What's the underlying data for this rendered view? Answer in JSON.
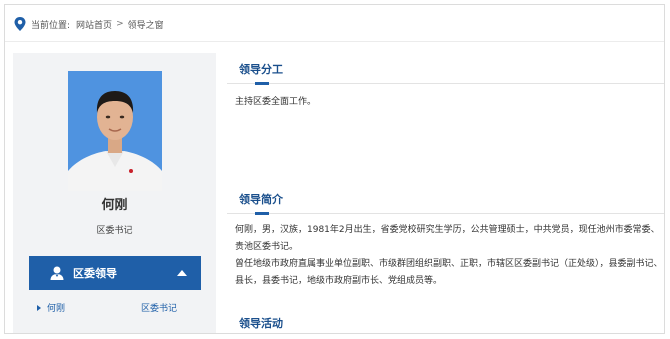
{
  "breadcrumb": {
    "prefix": "当前位置:",
    "home": "网站首页",
    "separator": ">",
    "current": "领导之窗"
  },
  "leader": {
    "name": "何刚",
    "title": "区委书记"
  },
  "sidebar": {
    "section_label": "区委领导",
    "items": [
      {
        "name": "何刚",
        "title": "区委书记"
      }
    ]
  },
  "sections": {
    "division": {
      "heading": "领导分工",
      "text": "主持区委全面工作。"
    },
    "profile": {
      "heading": "领导简介",
      "para1": "何刚，男，汉族，1981年2月出生，省委党校研究生学历，公共管理硕士，中共党员，现任池州市委常委、贵池区委书记。",
      "para2": "曾任地级市政府直属事业单位副职、市级群团组织副职、正职，市辖区区委副书记（正处级），县委副书记、县长，县委书记，地级市政府副市长、党组成员等。"
    },
    "activity": {
      "heading": "领导活动"
    }
  },
  "colors": {
    "accent": "#1f5fa8",
    "heading": "#1a4f8c",
    "sidebar_bg": "#f2f3f5",
    "photo_bg": "#4a90e2"
  },
  "icons": {
    "breadcrumb": "location-pin-icon",
    "leader_header": "user-icon",
    "toggle": "caret-up-icon",
    "item": "triangle-bullet-icon"
  }
}
